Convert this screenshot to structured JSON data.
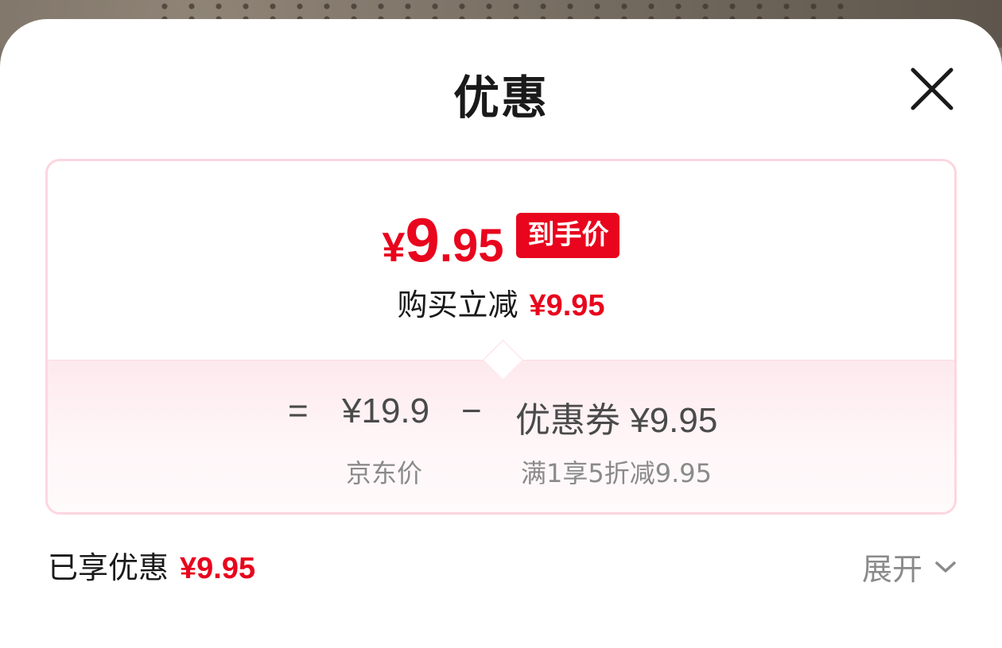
{
  "sheet": {
    "title": "优惠",
    "close_icon": "close-icon"
  },
  "summary": {
    "currency": "¥",
    "final_price_int": "9",
    "final_price_dec": ".95",
    "badge": "到手价",
    "instant_label": "购买立减",
    "instant_value": "¥9.95"
  },
  "formula": {
    "equals": "=",
    "base_price": "¥19.9",
    "minus": "−",
    "coupon_text": "优惠券 ¥9.95",
    "base_label": "京东价",
    "coupon_label": "满1享5折减9.95"
  },
  "footer": {
    "enjoyed_label": "已享优惠",
    "enjoyed_value": "¥9.95",
    "expand_label": "展开",
    "expand_icon": "chevron-down-icon"
  },
  "colors": {
    "accent": "#e8051d",
    "card_border": "#fdd6df",
    "muted": "#8a8a8a"
  }
}
